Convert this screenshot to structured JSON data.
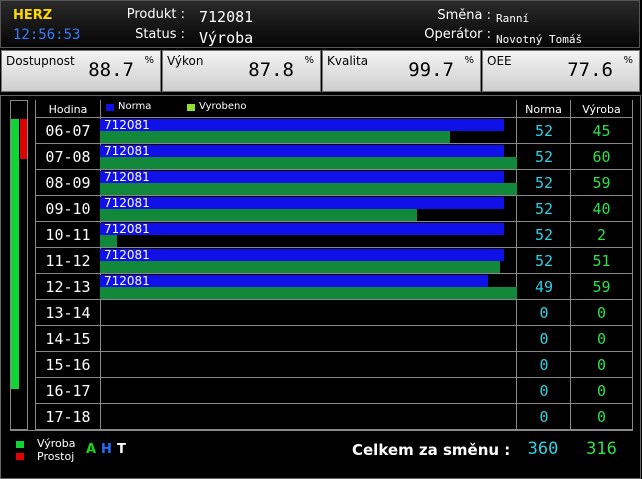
{
  "header": {
    "brand": "HERZ",
    "time": "12:56:53",
    "product_label": "Produkt :",
    "product_value": "712081",
    "status_label": "Status :",
    "status_value": "Výroba",
    "shift_label": "Směna :",
    "shift_value": "Ranní",
    "operator_label": "Operátor :",
    "operator_value": "Novotný Tomáš"
  },
  "kpis": [
    {
      "label": "Dostupnost",
      "value": "88.7",
      "unit": "%"
    },
    {
      "label": "Výkon",
      "value": "87.8",
      "unit": "%"
    },
    {
      "label": "Kvalita",
      "value": "99.7",
      "unit": "%"
    },
    {
      "label": "OEE",
      "value": "77.6",
      "unit": "%"
    }
  ],
  "table": {
    "col_hour": "Hodina",
    "legend_norma": "Norma",
    "legend_vyrobeno": "Vyrobeno",
    "col_norma": "Norma",
    "col_vyroba": "Výroba",
    "rows": [
      {
        "hour": "06-07",
        "product": "712081",
        "norma": "52",
        "vyroba": "45",
        "norma_fill": 0.97,
        "vyroba_fill": 0.84
      },
      {
        "hour": "07-08",
        "product": "712081",
        "norma": "52",
        "vyroba": "60",
        "norma_fill": 0.97,
        "vyroba_fill": 1.0
      },
      {
        "hour": "08-09",
        "product": "712081",
        "norma": "52",
        "vyroba": "59",
        "norma_fill": 0.97,
        "vyroba_fill": 1.0
      },
      {
        "hour": "09-10",
        "product": "712081",
        "norma": "52",
        "vyroba": "40",
        "norma_fill": 0.97,
        "vyroba_fill": 0.76
      },
      {
        "hour": "10-11",
        "product": "712081",
        "norma": "52",
        "vyroba": "2",
        "norma_fill": 0.97,
        "vyroba_fill": 0.04
      },
      {
        "hour": "11-12",
        "product": "712081",
        "norma": "52",
        "vyroba": "51",
        "norma_fill": 0.97,
        "vyroba_fill": 0.96
      },
      {
        "hour": "12-13",
        "product": "712081",
        "norma": "49",
        "vyroba": "59",
        "norma_fill": 0.93,
        "vyroba_fill": 1.0
      },
      {
        "hour": "13-14",
        "product": "",
        "norma": "0",
        "vyroba": "0",
        "norma_fill": 0,
        "vyroba_fill": 0
      },
      {
        "hour": "14-15",
        "product": "",
        "norma": "0",
        "vyroba": "0",
        "norma_fill": 0,
        "vyroba_fill": 0
      },
      {
        "hour": "15-16",
        "product": "",
        "norma": "0",
        "vyroba": "0",
        "norma_fill": 0,
        "vyroba_fill": 0
      },
      {
        "hour": "16-17",
        "product": "",
        "norma": "0",
        "vyroba": "0",
        "norma_fill": 0,
        "vyroba_fill": 0
      },
      {
        "hour": "17-18",
        "product": "",
        "norma": "0",
        "vyroba": "0",
        "norma_fill": 0,
        "vyroba_fill": 0
      }
    ]
  },
  "shift_bar": {
    "vyroba_fill": 0.87,
    "prostoj_fill": 0.13
  },
  "footer": {
    "legend_vyroba": "Výroba",
    "legend_prostoj": "Prostoj",
    "mode_a": "A",
    "mode_h": "H",
    "mode_t": "T",
    "total_label": "Celkem za směnu :",
    "total_norma": "360",
    "total_vyroba": "316"
  },
  "colors": {
    "norma_bar": "#1010e8",
    "vyroba_bar": "#12883a",
    "numbers_norma": "#2bd3e6",
    "numbers_vyroba": "#2ee04a",
    "brand": "#ffd800",
    "clock": "#3a7bff"
  }
}
